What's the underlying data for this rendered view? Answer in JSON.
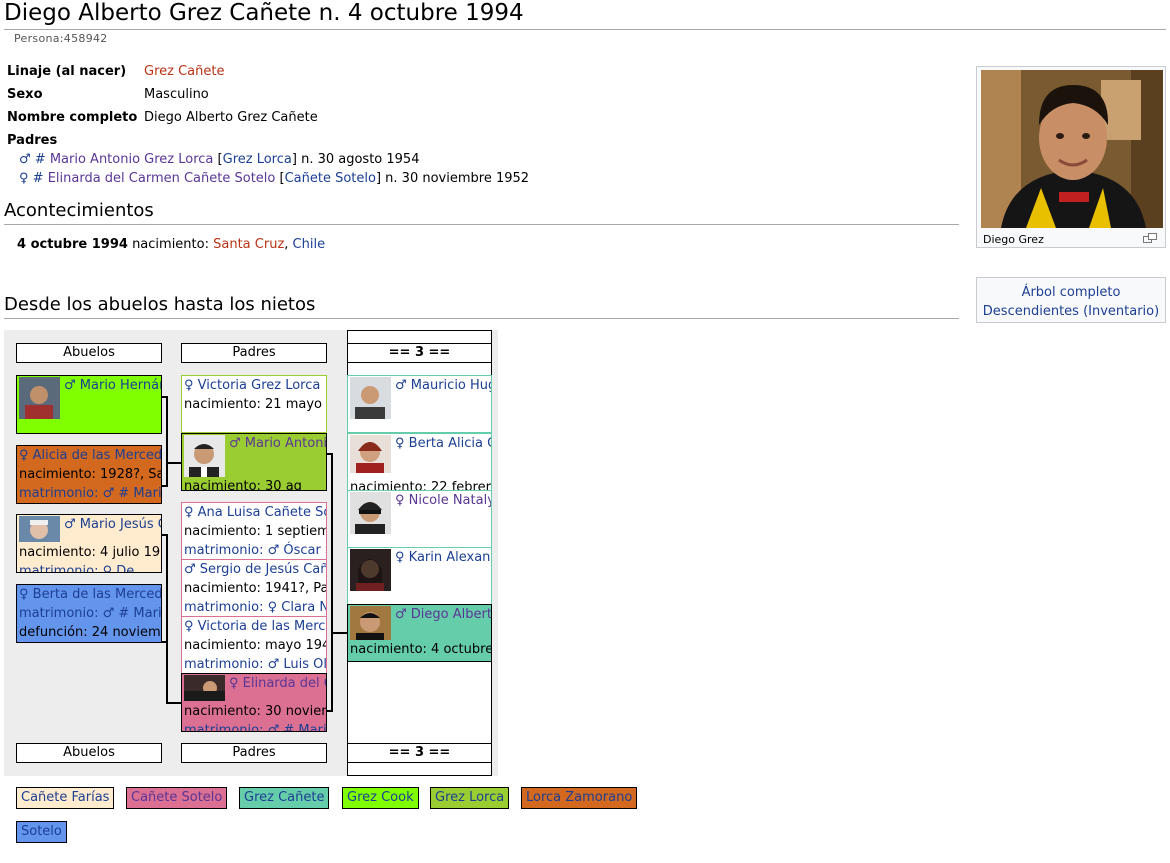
{
  "page": {
    "title": "Diego Alberto Grez Cañete n. 4 octubre 1994",
    "subtitle": "Persona:458942"
  },
  "fields": {
    "linaje_label": "Linaje (al nacer)",
    "linaje_value": "Grez Cañete",
    "sexo_label": "Sexo",
    "sexo_value": "Masculino",
    "nombre_label": "Nombre completo",
    "nombre_value": "Diego Alberto Grez Cañete",
    "padres_label": "Padres"
  },
  "parents": [
    {
      "sym": "♂ #",
      "name": "Mario Antonio Grez Lorca",
      "open": "[",
      "lineage": "Grez Lorca",
      "close": "]",
      "date": "n. 30 agosto 1954"
    },
    {
      "sym": "♀ #",
      "name": "Elinarda del Carmen Cañete Sotelo",
      "open": "[",
      "lineage": "Cañete Sotelo",
      "close": "]",
      "date": "n. 30 noviembre 1952"
    }
  ],
  "events": {
    "heading": "Acontecimientos",
    "date": "4 octubre 1994",
    "type": "nacimiento:",
    "place1": "Santa Cruz",
    "sep": ",",
    "place2": "Chile"
  },
  "photo": {
    "caption": "Diego Grez",
    "enlarge_icon": "enlarge-icon"
  },
  "side_links": {
    "full_tree": "Árbol completo",
    "descendants": "Descendientes (Inventario)"
  },
  "tree": {
    "heading": "Desde los abuelos hasta los nietos",
    "headers": {
      "col1": "Abuelos",
      "col2": "Padres",
      "col3": "== 3 =="
    },
    "grandparents": [
      {
        "name": "♂ Mario Hernán",
        "color": "#7fff00"
      },
      {
        "name": "♀ Alicia de las Merced",
        "line2": "nacimiento: 1928?, Sa",
        "line3": "matrimonio: ♂ # Mari",
        "color": "#d2691e"
      },
      {
        "name": "♂ Mario Jesús C",
        "line2": "nacimiento: 4 julio 191",
        "line3": "matrimonio: ♀ De",
        "color": "#ffebcd"
      },
      {
        "name": "♀ Berta de las Merced",
        "line2": "matrimonio: ♂ # Mari",
        "line3": "defunción: 24 noviemb",
        "color": "#6495ed"
      }
    ],
    "parents_col": [
      {
        "name": "♀ Victoria Grez Lorca",
        "line2": "nacimiento: 21 mayo 1",
        "color": "#ffffff"
      },
      {
        "name": "♂ Mario Antonio",
        "line2": "nacimiento: 30 ag",
        "color": "#9acd32"
      },
      {
        "name": "♀ Ana Luisa Cañete So",
        "line2": "nacimiento: 1 septiem",
        "line3": "matrimonio: ♂ Óscar S",
        "color": "#ffffff"
      },
      {
        "name": "♂ Sergio de Jesús Cañ",
        "line2": "nacimiento: 1941?, Pa",
        "line3": "matrimonio: ♀ Clara N",
        "color": "#ffffff"
      },
      {
        "name": "♀ Victoria de las Merce",
        "line2": "nacimiento: mayo 194",
        "line3": "matrimonio: ♂ Luis Oli",
        "color": "#ffffff"
      },
      {
        "name": "♀ Elinarda del C",
        "line2": "nacimiento: 30 noviem",
        "line3": "matrimonio: ♂ # Mari",
        "color": "#db7093"
      }
    ],
    "children": [
      {
        "name": "♂ Mauricio Hug",
        "color": "#ffffff"
      },
      {
        "name": "♀ Berta Alicia G",
        "line2": "nacimiento: 22 febrero",
        "color": "#ffffff"
      },
      {
        "name": "♀ Nicole Nataly",
        "color": "#ffffff"
      },
      {
        "name": "♀ Karin Alexand",
        "color": "#ffffff"
      },
      {
        "name": "♂ Diego Alberto",
        "line2": "nacimiento: 4 octubre",
        "color": "#66cdaa"
      }
    ]
  },
  "legend": [
    {
      "label": "Cañete Farías",
      "color": "#ffebcd"
    },
    {
      "label": "Cañete Sotelo",
      "color": "#db7093"
    },
    {
      "label": "Grez Cañete",
      "color": "#66cdaa"
    },
    {
      "label": "Grez Cook",
      "color": "#7fff00"
    },
    {
      "label": "Grez Lorca",
      "color": "#9acd32"
    },
    {
      "label": "Lorca Zamorano",
      "color": "#d2691e"
    },
    {
      "label": "Sotelo",
      "color": "#6495ed"
    }
  ]
}
